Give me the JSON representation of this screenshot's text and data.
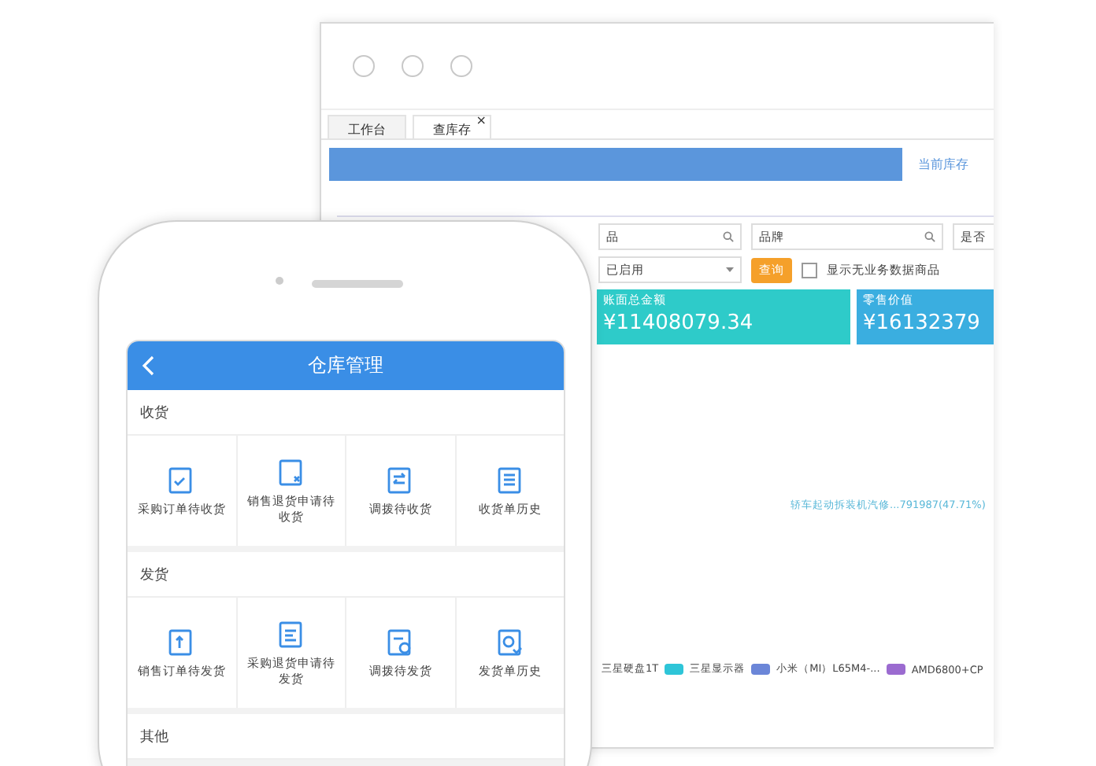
{
  "window": {
    "tabs": [
      {
        "label": "工作台",
        "selected": false
      },
      {
        "label": "查库存",
        "selected": true,
        "close": "×"
      }
    ],
    "banner_tab": "当前库存",
    "filters": {
      "field_1": "品",
      "field_2": "品牌",
      "field_3": "是否",
      "select": "已启用",
      "query_button": "查询",
      "checkbox": {
        "label": "显示无业务数据商品",
        "checked": false
      }
    },
    "cards": [
      {
        "title": "账面总金额",
        "value": "¥11408079.34",
        "color": "#2ecbc9"
      },
      {
        "title": "零售价值",
        "value": "¥16132379",
        "color": "#3aaee0"
      }
    ],
    "chart_label": "轿车起动拆装机汽修...791987(47.71%)",
    "legend": [
      {
        "label": "三星硬盘1T"
      },
      {
        "label": "三星显示器",
        "color": "#2ec5d8"
      },
      {
        "label": "小米（MI）L65M4-...",
        "color": "#6b86d8"
      },
      {
        "label": "AMD6800+CP",
        "color": "#9b6bd0"
      }
    ]
  },
  "phone": {
    "title": "仓库管理",
    "sections": [
      {
        "title": "收货",
        "items": [
          {
            "label": "采购订单待收货"
          },
          {
            "label": "销售退货申请待收货"
          },
          {
            "label": "调拨待收货"
          },
          {
            "label": "收货单历史"
          }
        ]
      },
      {
        "title": "发货",
        "items": [
          {
            "label": "销售订单待发货"
          },
          {
            "label": "采购退货申请待发货"
          },
          {
            "label": "调拨待发货"
          },
          {
            "label": "发货单历史"
          }
        ]
      },
      {
        "title": "其他"
      }
    ]
  }
}
